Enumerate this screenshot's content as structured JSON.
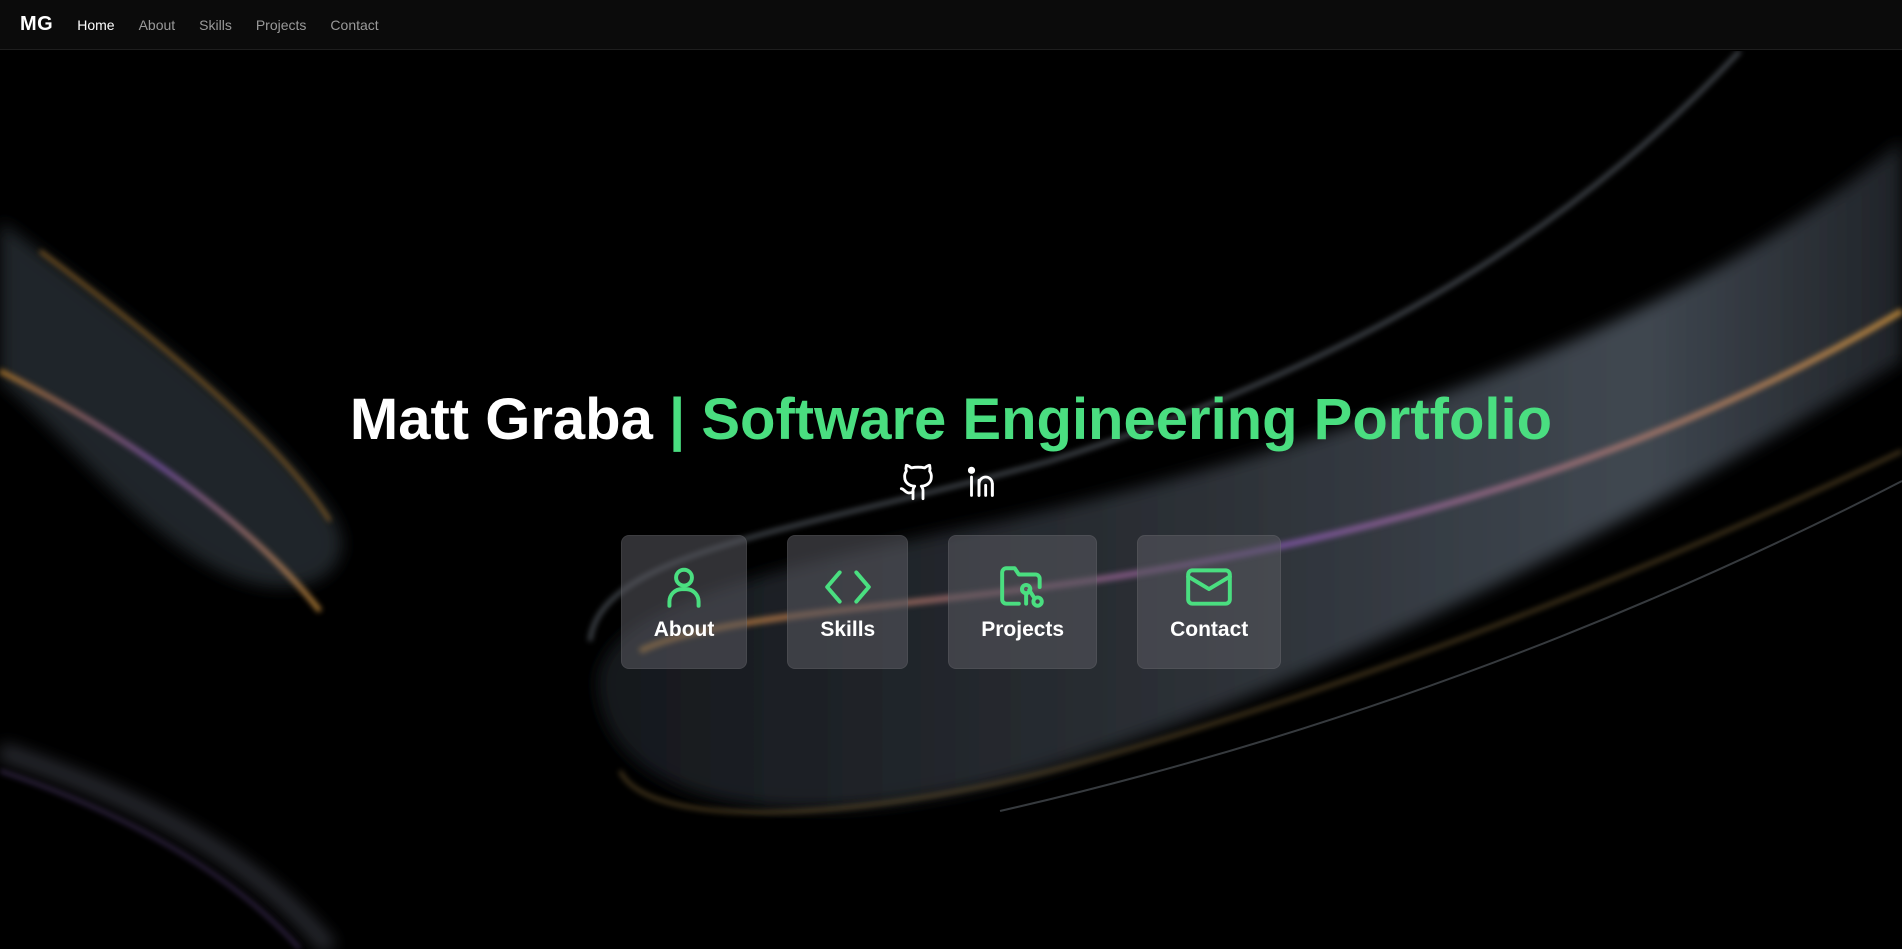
{
  "nav": {
    "brand": "MG",
    "links": [
      {
        "label": "Home",
        "active": true
      },
      {
        "label": "About",
        "active": false
      },
      {
        "label": "Skills",
        "active": false
      },
      {
        "label": "Projects",
        "active": false
      },
      {
        "label": "Contact",
        "active": false
      }
    ]
  },
  "hero": {
    "name": "Matt Graba",
    "separator": " | ",
    "subtitle": "Software Engineering Portfolio"
  },
  "social": [
    {
      "icon": "github-icon"
    },
    {
      "icon": "linkedin-icon"
    }
  ],
  "cards": [
    {
      "label": "About",
      "icon": "user-icon"
    },
    {
      "label": "Skills",
      "icon": "code-icon"
    },
    {
      "label": "Projects",
      "icon": "folder-icon"
    },
    {
      "label": "Contact",
      "icon": "mail-icon"
    }
  ],
  "colors": {
    "accent": "#4ade80",
    "background": "#000000",
    "navbar": "#0b0b0b",
    "card": "#5a5a60"
  }
}
